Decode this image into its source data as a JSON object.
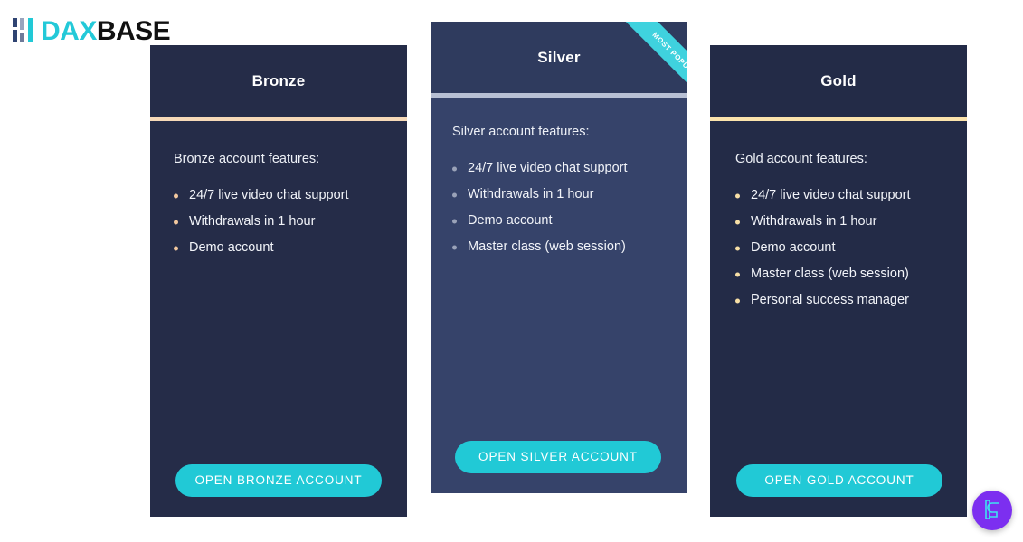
{
  "brand": {
    "logo_icon": "daxbase-bars-icon",
    "text_primary": "DAX",
    "text_secondary": "BASE",
    "color_accent": "#23c9d8",
    "color_dark": "#111111",
    "bar_colors": [
      "#2f4472",
      "#9aa4bd",
      "#21c9d6"
    ]
  },
  "plans": [
    {
      "id": "bronze",
      "title": "Bronze",
      "features_label": "Bronze account features:",
      "features": [
        "24/7 live video chat support",
        "Withdrawals in 1 hour",
        "Demo account"
      ],
      "cta_label": "OPEN BRONZE ACCOUNT",
      "accent_color": "#f6d9b8",
      "bullet_color": "#f3c89f",
      "card_color": "#252c48",
      "cta_color": "#21c9d6",
      "featured": false,
      "ribbon": null
    },
    {
      "id": "silver",
      "title": "Silver",
      "features_label": "Silver account features:",
      "features": [
        "24/7 live video chat support",
        "Withdrawals in 1 hour",
        "Demo account",
        "Master class (web session)"
      ],
      "cta_label": "OPEN SILVER ACCOUNT",
      "accent_color": "#b8c0d4",
      "bullet_color": "#9aa2b8",
      "card_color": "#36436a",
      "cta_color": "#21c9d6",
      "featured": true,
      "ribbon": "MOST POPULAR",
      "ribbon_color": "#3fd2de"
    },
    {
      "id": "gold",
      "title": "Gold",
      "features_label": "Gold account features:",
      "features": [
        "24/7 live video chat support",
        "Withdrawals in 1 hour",
        "Demo account",
        "Master class (web session)",
        "Personal success manager"
      ],
      "cta_label": "OPEN GOLD ACCOUNT",
      "accent_color": "#fbe3ac",
      "bullet_color": "#f7dfa6",
      "card_color": "#232b47",
      "cta_color": "#21c9d6",
      "featured": false,
      "ribbon": null
    }
  ],
  "floating_widget": {
    "icon": "chat-widget-logo-icon",
    "background_color": "#7c2ff0",
    "glyph_color": "#3ee3f0"
  }
}
